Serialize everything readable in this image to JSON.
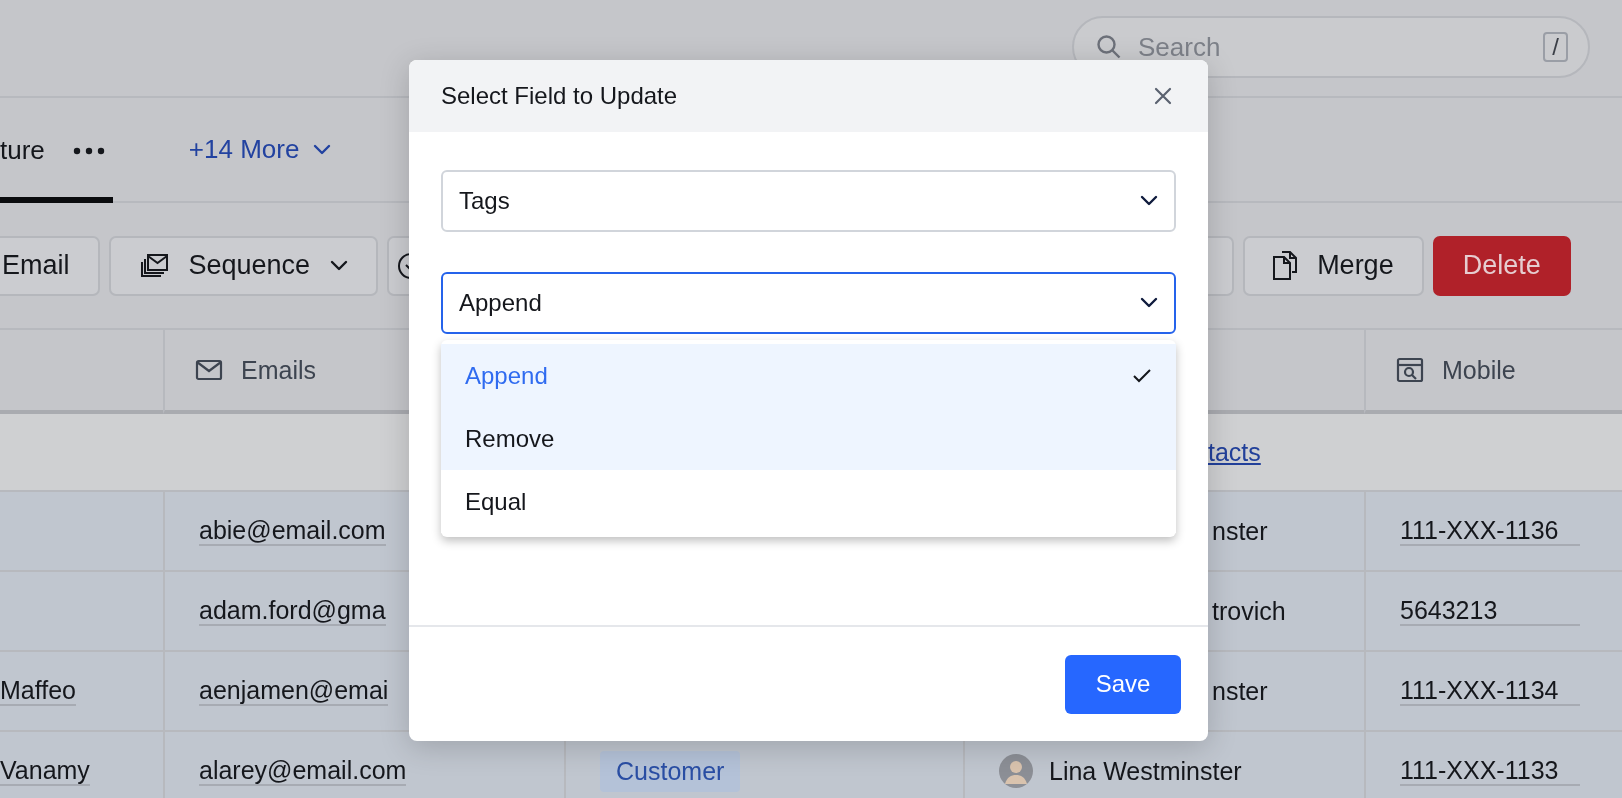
{
  "search": {
    "placeholder": "Search",
    "shortcut": "/"
  },
  "tabs": [
    {
      "label": "ture",
      "selected": true
    }
  ],
  "more_tabs": {
    "label": "+14 More"
  },
  "toolbar": [
    {
      "label": "Email",
      "kind": "plain"
    },
    {
      "label": "Sequence",
      "kind": "stack"
    },
    {
      "kind": "check"
    },
    {
      "kind": "blank"
    },
    {
      "label": "Merge",
      "kind": "file"
    },
    {
      "label": "Delete",
      "kind": "danger"
    }
  ],
  "table": {
    "columns": [
      {
        "kind": "blank"
      },
      {
        "label": "Emails",
        "kind": "mail"
      },
      {
        "kind": "blank"
      },
      {
        "kind": "blank"
      },
      {
        "label": "Mobile",
        "kind": "phone"
      }
    ],
    "banner": {
      "link": "tacts"
    },
    "rows": [
      {
        "selected": true,
        "emails": "abie@email.com",
        "column_4": {
          "text": "nster",
          "avatar": false
        },
        "mobile": "111-XXX-1136"
      },
      {
        "selected": true,
        "emails": "adam.ford@gma",
        "column_4": {
          "text": "trovich",
          "avatar": false
        },
        "mobile": "5643213"
      },
      {
        "selected": true,
        "column_1": "Maffeo",
        "emails": "aenjamen@emai",
        "column_4": {
          "text": "nster",
          "avatar": false
        },
        "mobile": "111-XXX-1134"
      },
      {
        "selected": true,
        "column_1": "Vanamy",
        "emails": "alarey@email.com",
        "column_3": "Customer",
        "column_4": {
          "text": "Lina Westminster",
          "avatar": true
        },
        "mobile": "111-XXX-1133"
      }
    ]
  },
  "modal": {
    "title": "Select Field to Update",
    "field": {
      "value": "Tags",
      "focused": false
    },
    "operation": {
      "value": "Append",
      "focused": true,
      "expanded": true,
      "options": [
        {
          "label": "Append",
          "selected": true,
          "highlighted": false
        },
        {
          "label": "Remove",
          "selected": false,
          "highlighted": true
        },
        {
          "label": "Equal",
          "selected": false,
          "highlighted": false
        }
      ]
    },
    "save": "Save"
  }
}
